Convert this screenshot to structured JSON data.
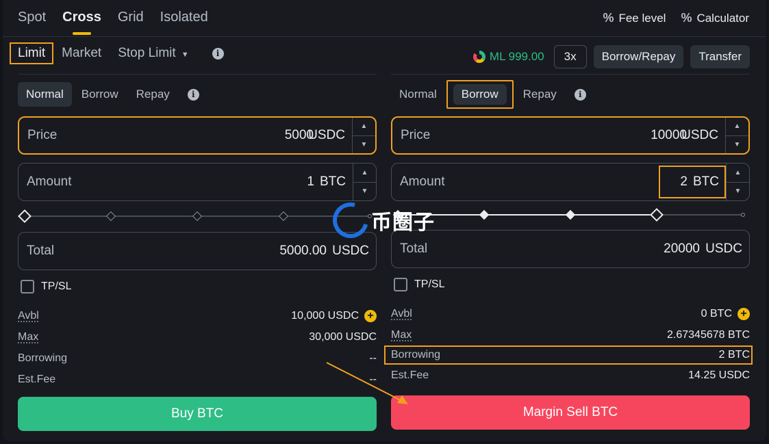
{
  "top_tabs": [
    {
      "label": "Spot"
    },
    {
      "label": "Cross"
    },
    {
      "label": "Grid"
    },
    {
      "label": "Isolated"
    }
  ],
  "top_right": {
    "fee_level": "Fee level",
    "calculator": "Calculator"
  },
  "order_types": [
    {
      "label": "Limit"
    },
    {
      "label": "Market"
    },
    {
      "label": "Stop Limit"
    }
  ],
  "info_glyph": "i",
  "margin": {
    "ml_label": "ML 999.00",
    "leverage": "3x",
    "borrow_repay": "Borrow/Repay",
    "transfer": "Transfer"
  },
  "buy_panel": {
    "modes": [
      "Normal",
      "Borrow",
      "Repay"
    ],
    "price": {
      "label": "Price",
      "value": "5000",
      "unit": "USDC"
    },
    "amount": {
      "label": "Amount",
      "value": "1",
      "unit": "BTC"
    },
    "slider_percent": 0,
    "total": {
      "label": "Total",
      "value": "5000.00",
      "unit": "USDC"
    },
    "tpsl": "TP/SL",
    "rows": [
      {
        "k": "Avbl",
        "v": "10,000 USDC"
      },
      {
        "k": "Max",
        "v": "30,000 USDC"
      },
      {
        "k": "Borrowing",
        "v": "--"
      },
      {
        "k": "Est.Fee",
        "v": "--"
      }
    ],
    "button": "Buy BTC"
  },
  "sell_panel": {
    "modes": [
      "Normal",
      "Borrow",
      "Repay"
    ],
    "price": {
      "label": "Price",
      "value": "10000",
      "unit": "USDC"
    },
    "amount": {
      "label": "Amount",
      "value": "2",
      "unit": "BTC"
    },
    "slider_percent": 75,
    "total": {
      "label": "Total",
      "value": "20000",
      "unit": "USDC"
    },
    "tpsl": "TP/SL",
    "rows": [
      {
        "k": "Avbl",
        "v": "0 BTC"
      },
      {
        "k": "Max",
        "v": "2.67345678 BTC"
      },
      {
        "k": "Borrowing",
        "v": "2 BTC"
      },
      {
        "k": "Est.Fee",
        "v": "14.25 USDC"
      }
    ],
    "button": "Margin Sell BTC"
  },
  "watermark": "币圈子",
  "colors": {
    "accent": "#f0b90b",
    "highlight": "#f0a020",
    "buy": "#2ebd85",
    "sell": "#f6465d",
    "bg": "#181a20"
  },
  "icons": {
    "fee_level": "percent-icon",
    "calculator": "calculator-icon",
    "ml": "margin-level-gauge-icon",
    "add": "plus-circle-icon",
    "info": "info-icon",
    "dropdown": "caret-down-icon"
  }
}
